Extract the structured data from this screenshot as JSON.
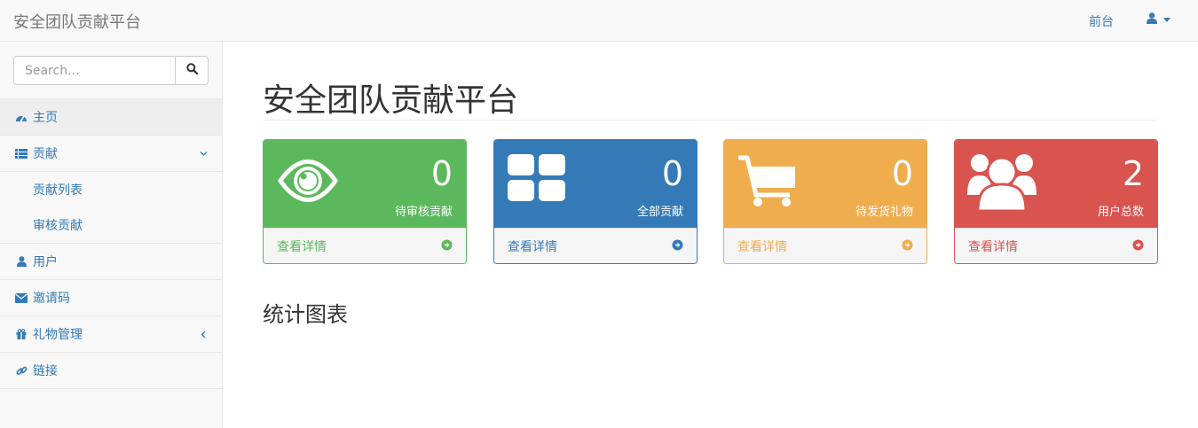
{
  "navbar": {
    "brand": "安全团队贡献平台",
    "front_link": "前台",
    "user_icon": "user-icon"
  },
  "sidebar": {
    "search": {
      "placeholder": "Search...",
      "value": ""
    },
    "items": [
      {
        "label": "主页",
        "icon": "dashboard-icon",
        "active": true
      },
      {
        "label": "贡献",
        "icon": "list-icon",
        "expanded": true,
        "children": [
          {
            "label": "贡献列表"
          },
          {
            "label": "审核贡献"
          }
        ]
      },
      {
        "label": "用户",
        "icon": "user-icon"
      },
      {
        "label": "邀请码",
        "icon": "envelope-icon"
      },
      {
        "label": "礼物管理",
        "icon": "gift-icon",
        "expanded": false
      },
      {
        "label": "链接",
        "icon": "link-icon"
      }
    ]
  },
  "main": {
    "title": "安全团队贡献平台",
    "panels": [
      {
        "count": "0",
        "label": "待审核贡献",
        "footer": "查看详情",
        "icon": "eye-icon",
        "color": "#5cb85c"
      },
      {
        "count": "0",
        "label": "全部贡献",
        "footer": "查看详情",
        "icon": "th-large-icon",
        "color": "#337ab7"
      },
      {
        "count": "0",
        "label": "待发货礼物",
        "footer": "查看详情",
        "icon": "shopping-cart-icon",
        "color": "#f0ad4e"
      },
      {
        "count": "2",
        "label": "用户总数",
        "footer": "查看详情",
        "icon": "users-icon",
        "color": "#d9534f"
      }
    ],
    "section_title": "统计图表"
  }
}
